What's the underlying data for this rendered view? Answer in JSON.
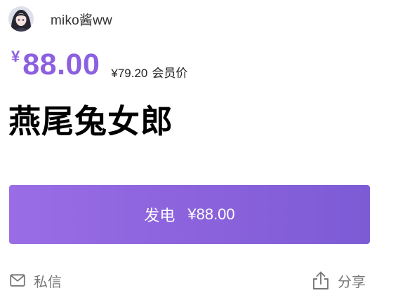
{
  "author": {
    "name": "miko酱ww",
    "avatar_icon": "avatar-illustration"
  },
  "price": {
    "currency_symbol": "¥",
    "amount": "88.00",
    "member_price": "¥79.20",
    "member_label": "会员价",
    "accent_color": "#8c60e0"
  },
  "product": {
    "title": "燕尾兔女郎"
  },
  "sponsor_button": {
    "label": "发电",
    "price": "¥88.00"
  },
  "actions": {
    "message_label": "私信",
    "message_icon": "mail-icon",
    "share_label": "分享",
    "share_icon": "share-icon"
  }
}
